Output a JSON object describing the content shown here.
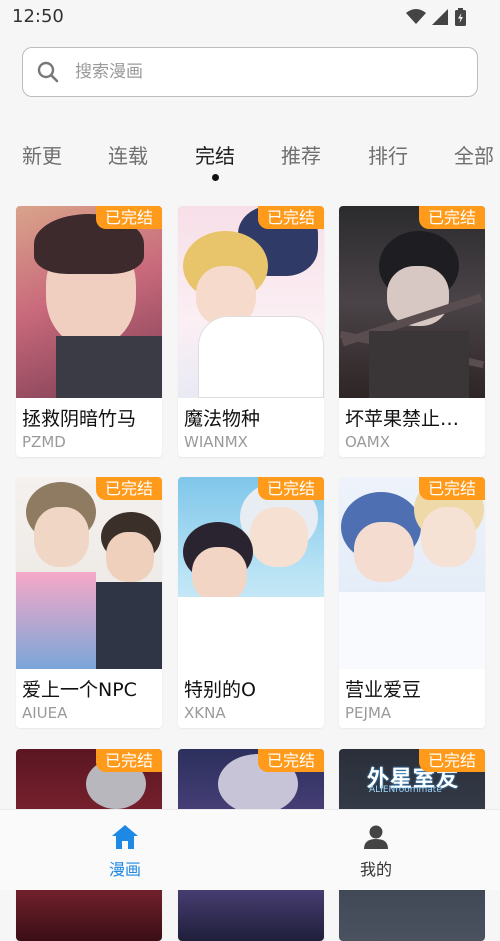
{
  "status": {
    "time": "12:50"
  },
  "search": {
    "placeholder": "搜索漫画"
  },
  "tabs": [
    {
      "label": "新更"
    },
    {
      "label": "连载"
    },
    {
      "label": "完结"
    },
    {
      "label": "推荐"
    },
    {
      "label": "排行"
    },
    {
      "label": "全部"
    }
  ],
  "active_tab": "完结",
  "badge_label": "已完结",
  "comics": [
    {
      "title": "拯救阴暗竹马",
      "code": "PZMD"
    },
    {
      "title": "魔法物种",
      "code": "WIANMX"
    },
    {
      "title": "坏苹果禁止…",
      "code": "OAMX"
    },
    {
      "title": "爱上一个NPC",
      "code": "AIUEA"
    },
    {
      "title": "特别的O",
      "code": "XKNA"
    },
    {
      "title": "营业爱豆",
      "code": "PEJMA"
    }
  ],
  "partial_cover_text": "外星室友",
  "partial_cover_subtext": "ALIENroommate",
  "bottom_nav": [
    {
      "label": "漫画",
      "icon": "home-icon",
      "active": true
    },
    {
      "label": "我的",
      "icon": "person-icon",
      "active": false
    }
  ],
  "colors": {
    "accent": "#1e88e5",
    "badge": "#ff9a1a",
    "inactive_nav": "#333333"
  }
}
